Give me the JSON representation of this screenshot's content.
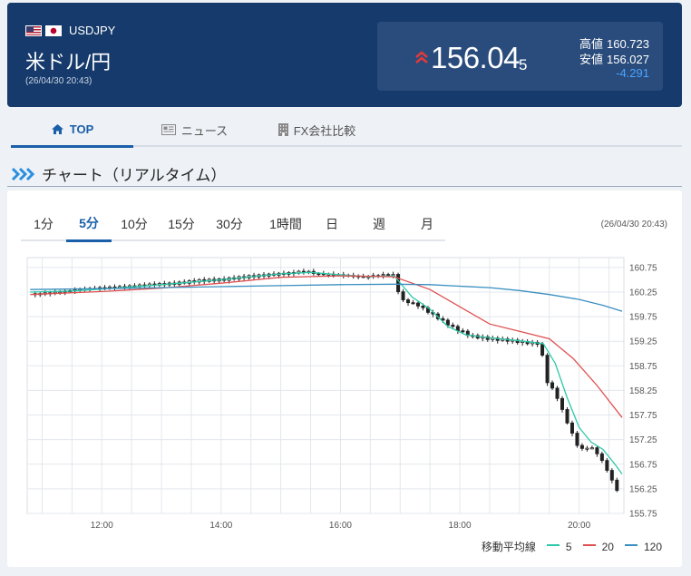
{
  "header": {
    "pair_code": "USDJPY",
    "pair_name": "米ドル/円",
    "timestamp": "(26/04/30 20:43)",
    "price_main": "156.04",
    "price_tail": "5",
    "direction_icon": "double-chevron-up-icon",
    "high_label": "高値",
    "high_value": "160.723",
    "low_label": "安値",
    "low_value": "156.027",
    "change": "-4.291"
  },
  "nav": {
    "tabs": [
      {
        "label": "TOP",
        "icon": "home-icon",
        "active": true
      },
      {
        "label": "ニュース",
        "icon": "newspaper-icon",
        "active": false
      },
      {
        "label": "FX会社比較",
        "icon": "building-icon",
        "active": false
      }
    ]
  },
  "section": {
    "title": "チャート（リアルタイム）",
    "icon": "triple-chevron-right-icon"
  },
  "periods": {
    "items": [
      "1分",
      "5分",
      "10分",
      "15分",
      "30分",
      "1時間",
      "日",
      "週",
      "月"
    ],
    "active": "5分"
  },
  "chart_stamp": "(26/04/30 20:43)",
  "colors": {
    "accent": "#1a5fa8",
    "ma5": "#2cc8a8",
    "ma20": "#e05050",
    "ma120": "#3a8fc0",
    "header_bg": "#163a6b",
    "down_arrow": "#e03a3a"
  },
  "legend": {
    "label": "移動平均線",
    "items": [
      {
        "name": "5"
      },
      {
        "name": "20"
      },
      {
        "name": "120"
      }
    ]
  },
  "chart_data": {
    "type": "candlestick",
    "x_ticks": [
      "12:00",
      "14:00",
      "16:00",
      "18:00",
      "20:00"
    ],
    "y_ticks": [
      160.75,
      160.25,
      159.75,
      159.25,
      158.75,
      158.25,
      157.75,
      157.25,
      156.75,
      156.25,
      155.75
    ],
    "ylim": [
      155.75,
      160.95
    ],
    "x_range_hours": [
      10.75,
      20.75
    ],
    "grid": true,
    "close": [
      [
        10.8,
        160.2
      ],
      [
        11.2,
        160.24
      ],
      [
        11.6,
        160.3
      ],
      [
        12.0,
        160.34
      ],
      [
        12.4,
        160.36
      ],
      [
        12.8,
        160.4
      ],
      [
        13.2,
        160.42
      ],
      [
        13.6,
        160.48
      ],
      [
        14.0,
        160.5
      ],
      [
        14.4,
        160.56
      ],
      [
        14.8,
        160.6
      ],
      [
        15.2,
        160.64
      ],
      [
        15.4,
        160.68
      ],
      [
        15.6,
        160.62
      ],
      [
        16.0,
        160.6
      ],
      [
        16.4,
        160.56
      ],
      [
        16.7,
        160.6
      ],
      [
        16.9,
        160.6
      ],
      [
        17.0,
        160.1
      ],
      [
        17.3,
        159.98
      ],
      [
        17.6,
        159.75
      ],
      [
        17.9,
        159.52
      ],
      [
        18.2,
        159.35
      ],
      [
        18.5,
        159.3
      ],
      [
        18.8,
        159.27
      ],
      [
        19.1,
        159.22
      ],
      [
        19.35,
        159.2
      ],
      [
        19.45,
        158.45
      ],
      [
        19.6,
        158.2
      ],
      [
        19.8,
        157.6
      ],
      [
        20.0,
        157.05
      ],
      [
        20.2,
        157.1
      ],
      [
        20.35,
        156.9
      ],
      [
        20.5,
        156.55
      ],
      [
        20.7,
        156.05
      ]
    ],
    "series": [
      {
        "name": "5",
        "values": [
          [
            10.8,
            160.25
          ],
          [
            11.5,
            160.27
          ],
          [
            12.0,
            160.31
          ],
          [
            13.0,
            160.4
          ],
          [
            14.0,
            160.5
          ],
          [
            15.0,
            160.62
          ],
          [
            15.5,
            160.65
          ],
          [
            16.0,
            160.6
          ],
          [
            16.5,
            160.56
          ],
          [
            16.9,
            160.58
          ],
          [
            17.2,
            160.15
          ],
          [
            17.5,
            159.9
          ],
          [
            17.8,
            159.55
          ],
          [
            18.1,
            159.38
          ],
          [
            18.5,
            159.32
          ],
          [
            19.0,
            159.26
          ],
          [
            19.4,
            159.2
          ],
          [
            19.6,
            158.8
          ],
          [
            19.8,
            158.1
          ],
          [
            20.0,
            157.5
          ],
          [
            20.2,
            157.2
          ],
          [
            20.4,
            157.05
          ],
          [
            20.6,
            156.75
          ],
          [
            20.72,
            156.55
          ]
        ]
      },
      {
        "name": "20",
        "values": [
          [
            10.8,
            160.2
          ],
          [
            12.0,
            160.26
          ],
          [
            13.0,
            160.33
          ],
          [
            14.0,
            160.43
          ],
          [
            15.0,
            160.55
          ],
          [
            16.0,
            160.58
          ],
          [
            16.9,
            160.56
          ],
          [
            17.5,
            160.3
          ],
          [
            18.0,
            159.95
          ],
          [
            18.5,
            159.6
          ],
          [
            19.0,
            159.45
          ],
          [
            19.5,
            159.3
          ],
          [
            19.9,
            158.9
          ],
          [
            20.3,
            158.35
          ],
          [
            20.72,
            157.7
          ]
        ]
      },
      {
        "name": "120",
        "values": [
          [
            10.8,
            160.3
          ],
          [
            12.0,
            160.32
          ],
          [
            13.0,
            160.34
          ],
          [
            14.0,
            160.36
          ],
          [
            15.0,
            160.38
          ],
          [
            16.0,
            160.4
          ],
          [
            16.9,
            160.41
          ],
          [
            17.5,
            160.4
          ],
          [
            18.0,
            160.37
          ],
          [
            18.5,
            160.34
          ],
          [
            19.0,
            160.28
          ],
          [
            19.5,
            160.2
          ],
          [
            20.0,
            160.1
          ],
          [
            20.4,
            159.98
          ],
          [
            20.72,
            159.86
          ]
        ]
      }
    ]
  }
}
